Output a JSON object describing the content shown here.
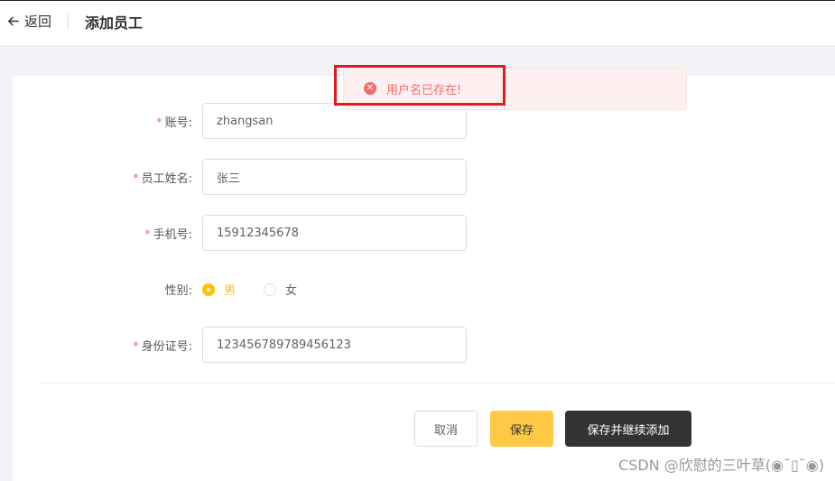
{
  "header": {
    "back_label": "返回",
    "title": "添加员工"
  },
  "toast": {
    "message": "用户名已存在!",
    "icon": "error-circle-icon",
    "color": "#f56c6c"
  },
  "form": {
    "required_mark": "*",
    "username": {
      "label": "账号:",
      "value": "zhangsan"
    },
    "name": {
      "label": "员工姓名:",
      "value": "张三"
    },
    "phone": {
      "label": "手机号:",
      "value": "15912345678"
    },
    "gender": {
      "label": "性别:",
      "options": [
        "男",
        "女"
      ],
      "selected": "男"
    },
    "id_number": {
      "label": "身份证号:",
      "value": "123456789789456123"
    }
  },
  "actions": {
    "cancel": "取消",
    "save": "保存",
    "save_continue": "保存并继续添加"
  },
  "watermark": "CSDN @欣慰的三叶草(◉¯▯¯◉)",
  "colors": {
    "accent": "#ffc200",
    "primary_button": "#ffc845",
    "dark_button": "#333333",
    "error": "#f56c6c",
    "highlight_box": "#e8191c"
  }
}
